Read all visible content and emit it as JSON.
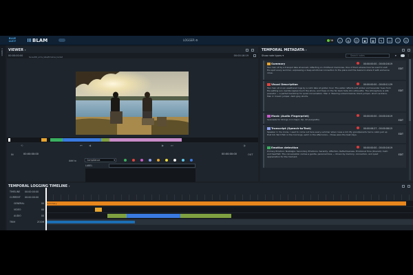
{
  "topbar": {
    "logo_line1": "BLUE",
    "logo_line2": "LUCY",
    "product": "BLAM",
    "logger_label": "LOGGER",
    "count": "38"
  },
  "sidebar": {
    "label": "PANELS"
  },
  "viewer": {
    "title": "VIEWER",
    "timecode_left": "00:00:00:00",
    "filename": "Sunset02_arms_label/timeline_bucket",
    "timecode_right": "00:00:16:19",
    "in_label": "IN",
    "in_tc": "00:00:00:00",
    "out_tc": "00:00:00:00",
    "out_label": "OUT",
    "add_to_label": "Add to",
    "add_to_value": "Compliance",
    "label_label": "LABEL",
    "clear_label": "CLEAR",
    "tag_colors": [
      "#3ab060",
      "#e0443e",
      "#c85aca",
      "#8ea0ee",
      "#e8a52e",
      "#f0dd3a",
      "#f2f2f2",
      "#5fc7e8",
      "#3a7ae0"
    ]
  },
  "temporal": {
    "title": "TEMPORAL METADATA",
    "show_types": "Show note types",
    "search_placeholder": "Search notes",
    "edit_label": "EDIT",
    "cards": [
      {
        "title": "Summary",
        "tc": "00:00:00:00 - 00:00:16:19",
        "color": "#e8a52e",
        "body": "Two men sit by a tranquil lake at sunset, reflecting on childhood memories. One of them shares how he used to visit the spot every summer, expressing a deep emotional connection to the place and the desire to share it with someone close."
      },
      {
        "title": "Visual Description",
        "tc": "00:00:00:00 - 00:00:11:29",
        "color": "#e0443e",
        "body": "Two men sit on an weathered logs by a calm lake at golden hour. The water reflects soft amber and lavender hues from the setting sun. Gentle ripples touch the shore, and trees on the far bank fade into silhouette. The atmosphere is still, peaceful — a perfect backdrop for quiet conversation. Man 1: Wearing a black beanie, black jumper, short necklace. Man 2: Cream jumper, dark grey shorts."
      },
      {
        "title": "Music (Audio Fingerprint)",
        "tc": "00:00:00:00 - 00:00:16:19",
        "color": "#c85aca",
        "body": "Serenade for Strings in C major, Op. 22 (Largretto)"
      },
      {
        "title": "Transcript (Speech-to-Text)",
        "tc": "00:00:06:27 - 00:00:08:15",
        "color": "#8ea0ee",
        "body": "Speaker 1: You know, I used to come out here every summer when I was a kid. My grandparents had a cabin just up that hill. We'd fish in the mornings, swim in the afternoons... those were the best days."
      },
      {
        "title": "Emotion detection",
        "tc": "00:00:00:00 - 00:00:16:19",
        "color": "#3ab060",
        "body": "Primary Emotion: Nostalgia. Secondary Emotions: Serenity, Affection, Reflectiveness. Emotional Tone (Overall): Calm and heartfelt. The conversation carries a gentle, personal tone — driven by memory, connection, and quiet appreciation for the moment."
      }
    ],
    "page_size_label": "Page Size:",
    "page_size_value": "50",
    "page_info": "Page 1 of 1"
  },
  "timeline": {
    "title": "TEMPORAL LOGGING TIMELINE",
    "rows": [
      {
        "label": "TIMELINE",
        "sub": "00:00:00:00"
      },
      {
        "label": "CURRENT",
        "sub": "00:00:00:00"
      },
      {
        "label": "GENERAL",
        "sub": "00"
      },
      {
        "label": "VIDEO",
        "sub": "00"
      },
      {
        "label": "AUDIO",
        "sub": "00"
      },
      {
        "label": "TRIM",
        "sub": "ZOOM"
      }
    ],
    "general_bar_label": "Summary"
  }
}
